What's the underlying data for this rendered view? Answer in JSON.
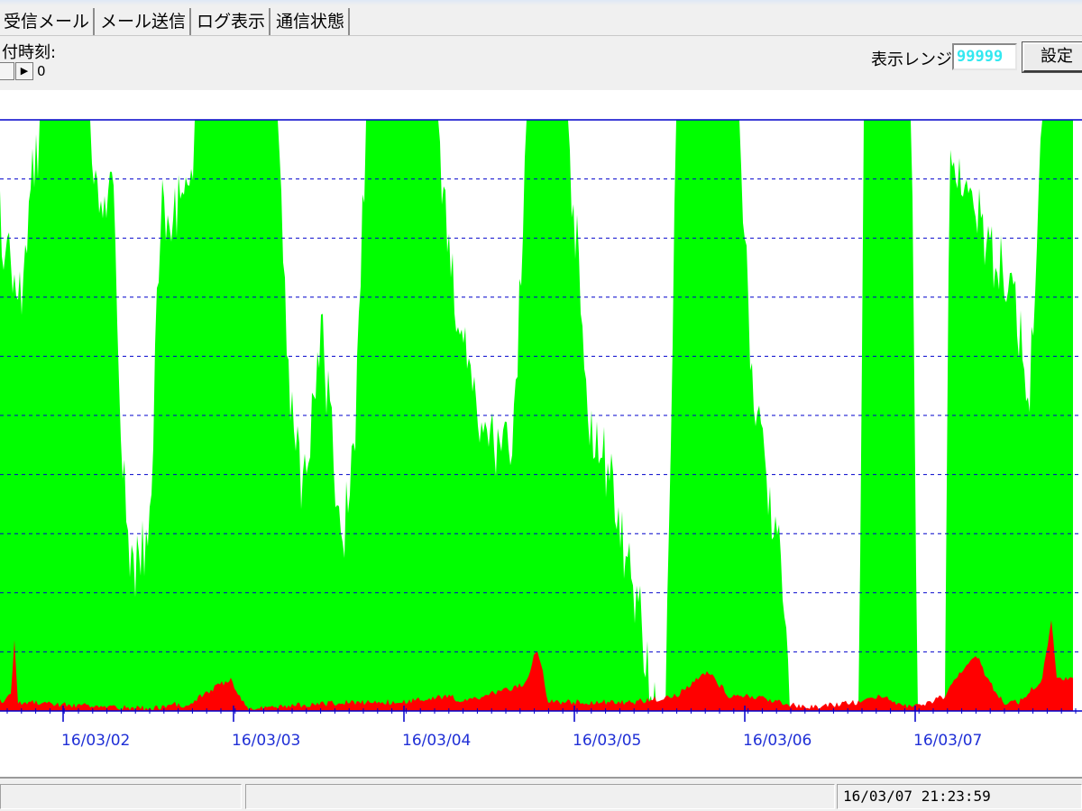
{
  "tabs": [
    {
      "label": "受信メール"
    },
    {
      "label": "メール送信"
    },
    {
      "label": "ログ表示"
    },
    {
      "label": "通信状態"
    }
  ],
  "date_time_label": "付時刻:",
  "spin_value": "0",
  "range": {
    "label": "表示レンジ:",
    "value": "99999"
  },
  "set_button_label": "設定",
  "status": {
    "datetime": "16/03/07 21:23:59"
  },
  "colors": {
    "received": "#00ff00",
    "error": "#ff0000",
    "grid": "#0000cc",
    "axis_labels": "#1f2fd6",
    "range_text": "#33e8f0"
  },
  "chart_data": {
    "type": "area",
    "x_tick_labels": [
      "16/03/02",
      "16/03/03",
      "16/03/04",
      "16/03/05",
      "16/03/06",
      "16/03/07"
    ],
    "ylim": [
      0,
      99999
    ],
    "grid": "horizontal-dashed",
    "green_envelope_fraction": [
      [
        0.0,
        0.88
      ],
      [
        0.01,
        0.8
      ],
      [
        0.02,
        0.78
      ],
      [
        0.03,
        0.95
      ],
      [
        0.036,
        1.0
      ],
      [
        0.085,
        1.0
      ],
      [
        0.095,
        0.9
      ],
      [
        0.105,
        0.95
      ],
      [
        0.115,
        0.45
      ],
      [
        0.12,
        0.33
      ],
      [
        0.13,
        0.3
      ],
      [
        0.14,
        0.4
      ],
      [
        0.15,
        0.92
      ],
      [
        0.165,
        0.9
      ],
      [
        0.18,
        1.0
      ],
      [
        0.26,
        1.0
      ],
      [
        0.27,
        0.6
      ],
      [
        0.28,
        0.45
      ],
      [
        0.29,
        0.55
      ],
      [
        0.3,
        0.7
      ],
      [
        0.31,
        0.5
      ],
      [
        0.32,
        0.35
      ],
      [
        0.33,
        0.5
      ],
      [
        0.34,
        1.0
      ],
      [
        0.41,
        1.0
      ],
      [
        0.42,
        0.8
      ],
      [
        0.43,
        0.7
      ],
      [
        0.44,
        0.6
      ],
      [
        0.45,
        0.55
      ],
      [
        0.46,
        0.5
      ],
      [
        0.47,
        0.5
      ],
      [
        0.48,
        0.55
      ],
      [
        0.49,
        1.0
      ],
      [
        0.53,
        1.0
      ],
      [
        0.54,
        0.8
      ],
      [
        0.55,
        0.55
      ],
      [
        0.56,
        0.5
      ],
      [
        0.57,
        0.45
      ],
      [
        0.58,
        0.35
      ],
      [
        0.59,
        0.28
      ],
      [
        0.6,
        0.18
      ],
      [
        0.61,
        0.05
      ],
      [
        0.62,
        0.02
      ],
      [
        0.63,
        1.0
      ],
      [
        0.69,
        1.0
      ],
      [
        0.7,
        0.65
      ],
      [
        0.71,
        0.5
      ],
      [
        0.72,
        0.4
      ],
      [
        0.73,
        0.3
      ],
      [
        0.74,
        0.0
      ],
      [
        0.8,
        0.0
      ],
      [
        0.805,
        1.0
      ],
      [
        0.85,
        1.0
      ],
      [
        0.855,
        0.0
      ],
      [
        0.88,
        0.0
      ],
      [
        0.885,
        1.0
      ],
      [
        0.9,
        0.95
      ],
      [
        0.92,
        0.85
      ],
      [
        0.94,
        0.8
      ],
      [
        0.96,
        0.6
      ],
      [
        0.97,
        1.0
      ],
      [
        0.99,
        1.0
      ],
      [
        1.0,
        1.0
      ]
    ],
    "red_spikes_fraction": [
      [
        0.0,
        0.02
      ],
      [
        0.01,
        0.03
      ],
      [
        0.014,
        0.14
      ],
      [
        0.016,
        0.02
      ],
      [
        0.12,
        0.01
      ],
      [
        0.15,
        0.01
      ],
      [
        0.16,
        0.02
      ],
      [
        0.17,
        0.01
      ],
      [
        0.215,
        0.06
      ],
      [
        0.22,
        0.04
      ],
      [
        0.23,
        0.01
      ],
      [
        0.33,
        0.02
      ],
      [
        0.34,
        0.02
      ],
      [
        0.37,
        0.02
      ],
      [
        0.42,
        0.03
      ],
      [
        0.43,
        0.02
      ],
      [
        0.49,
        0.05
      ],
      [
        0.5,
        0.11
      ],
      [
        0.505,
        0.08
      ],
      [
        0.51,
        0.02
      ],
      [
        0.59,
        0.02
      ],
      [
        0.63,
        0.03
      ],
      [
        0.65,
        0.06
      ],
      [
        0.66,
        0.07
      ],
      [
        0.67,
        0.05
      ],
      [
        0.68,
        0.03
      ],
      [
        0.7,
        0.03
      ],
      [
        0.73,
        0.02
      ],
      [
        0.75,
        0.01
      ],
      [
        0.8,
        0.02
      ],
      [
        0.82,
        0.03
      ],
      [
        0.85,
        0.01
      ],
      [
        0.88,
        0.03
      ],
      [
        0.89,
        0.06
      ],
      [
        0.9,
        0.08
      ],
      [
        0.91,
        0.1
      ],
      [
        0.92,
        0.06
      ],
      [
        0.935,
        0.02
      ],
      [
        0.95,
        0.02
      ],
      [
        0.96,
        0.04
      ],
      [
        0.97,
        0.05
      ],
      [
        0.98,
        0.16
      ],
      [
        0.985,
        0.06
      ]
    ]
  }
}
